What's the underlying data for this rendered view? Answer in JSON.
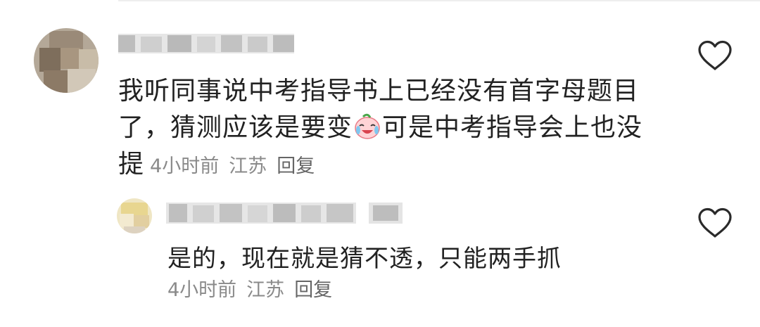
{
  "comment": {
    "text_before_emoji": "我听同事说中考指导书上已经没有首字母题目了，猜测应该是要变",
    "emoji": "crying-laughing-peach-emoji",
    "text_after_emoji": "可是中考指导会上也没提",
    "time": "4小时前",
    "location": "江苏",
    "reply_label": "回复",
    "like_icon": "heart-outline-icon"
  },
  "reply": {
    "text": "是的，现在就是猜不透，只能两手抓",
    "time": "4小时前",
    "location": "江苏",
    "reply_label": "回复",
    "like_icon": "heart-outline-icon"
  },
  "colors": {
    "text": "#222222",
    "meta": "#8a8a8a",
    "icon": "#2a2a2a"
  }
}
